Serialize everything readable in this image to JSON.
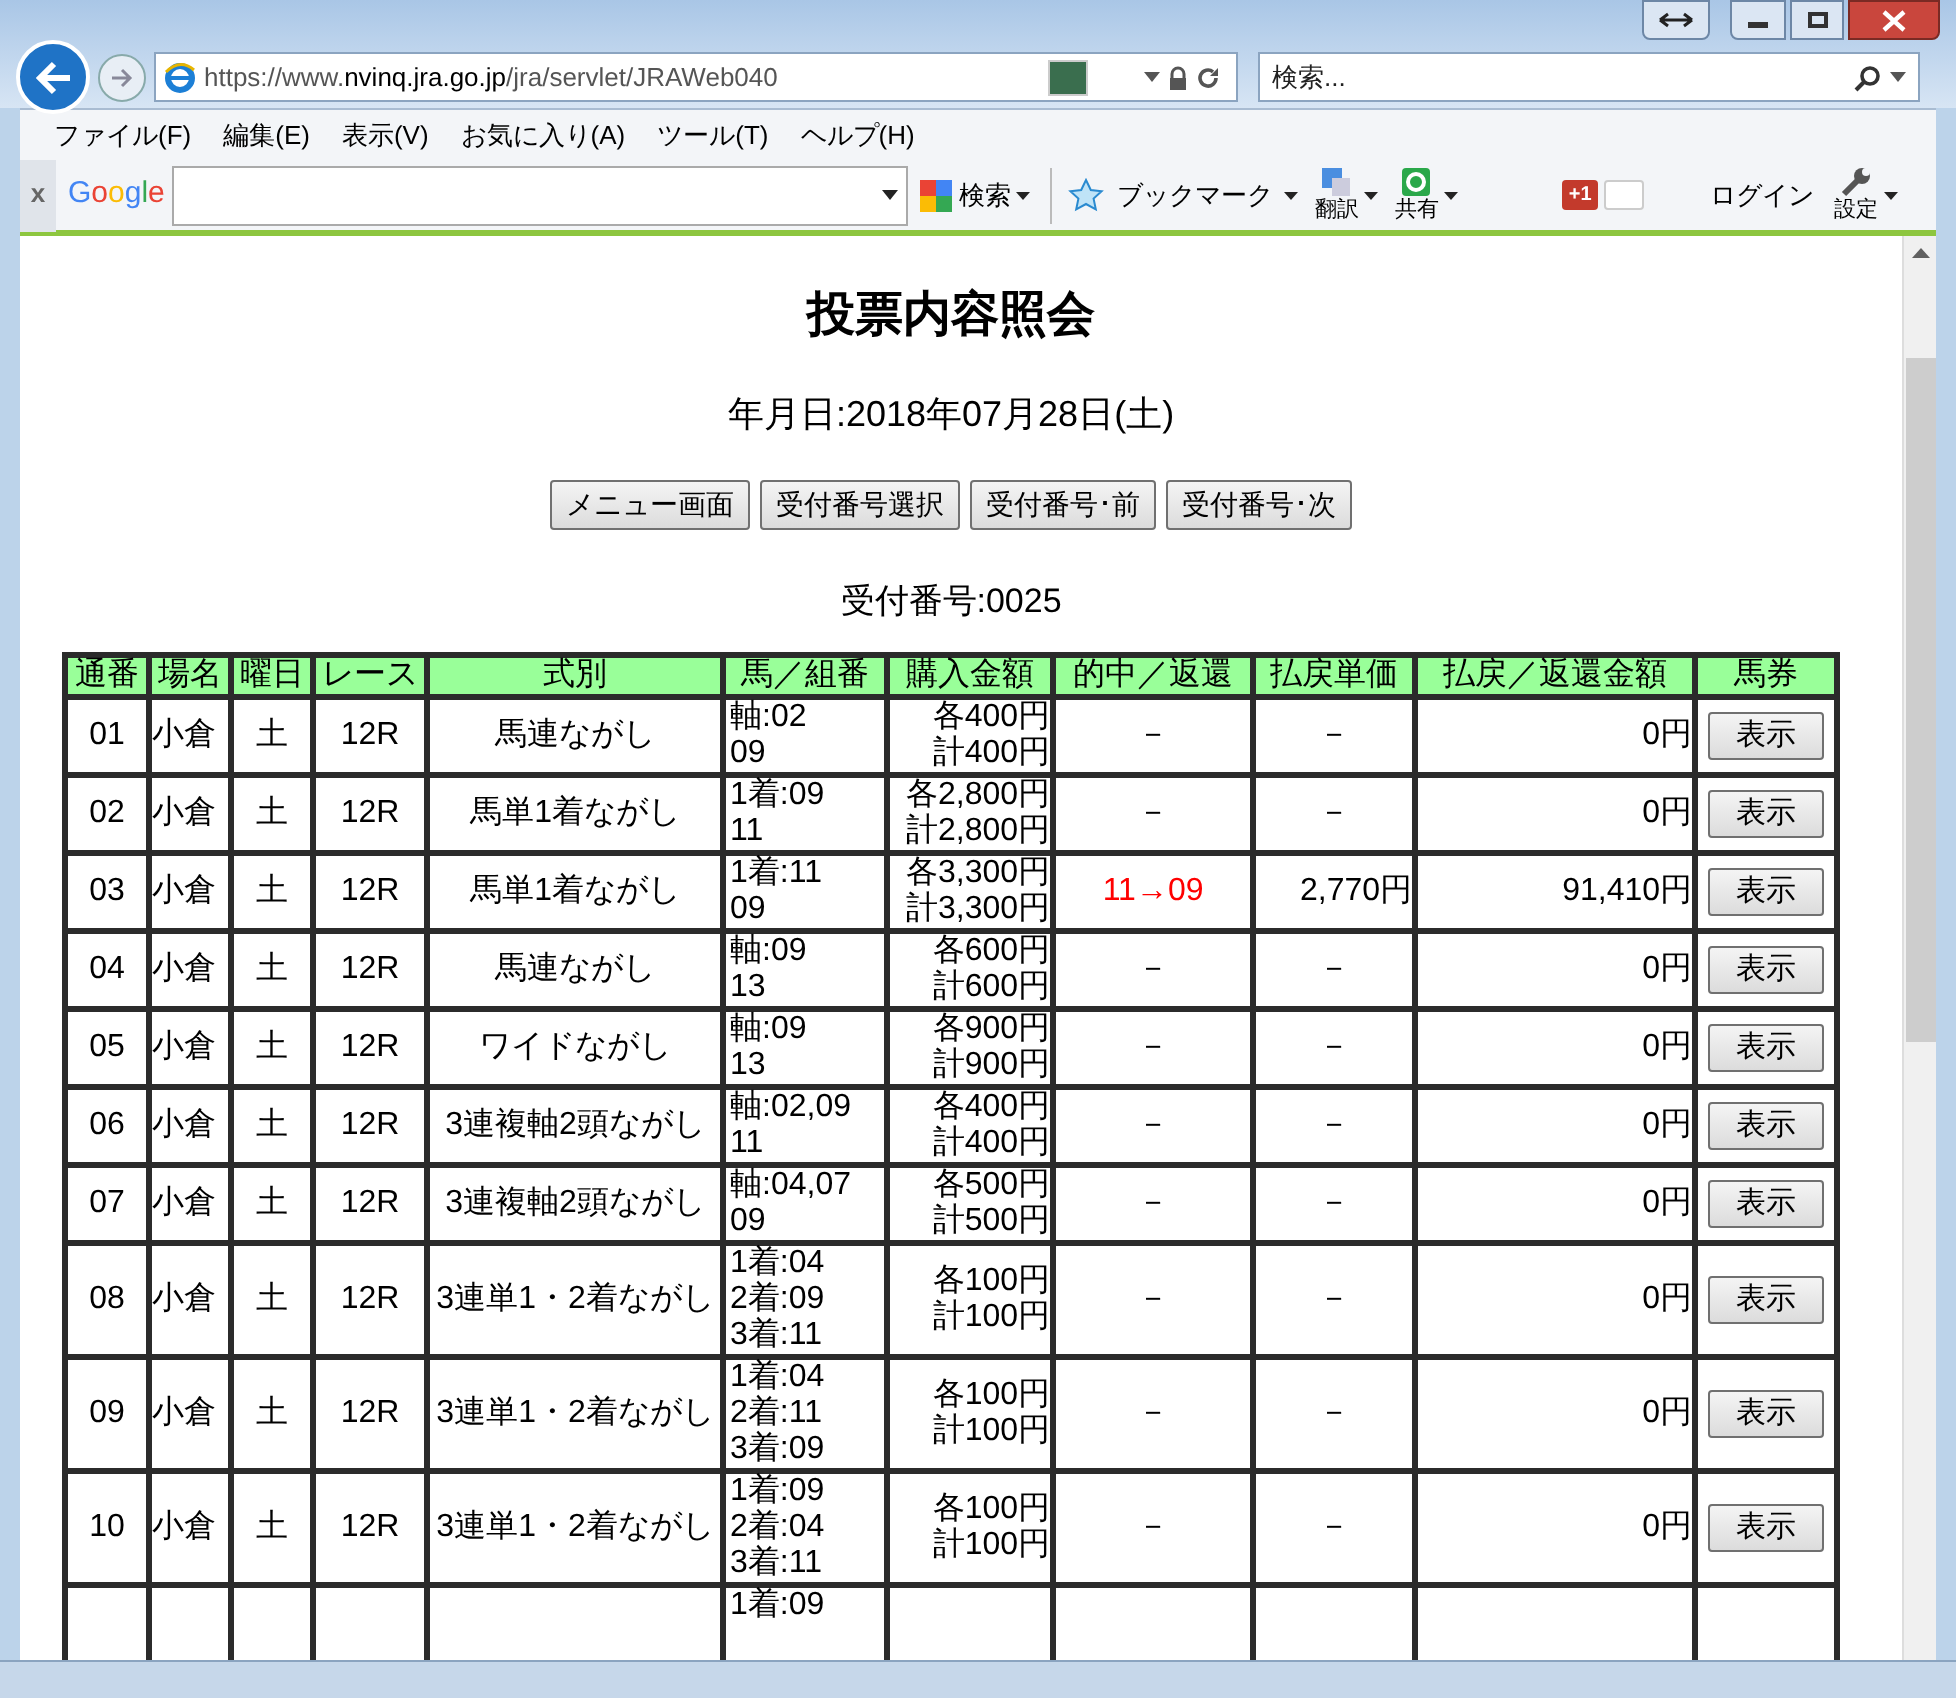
{
  "browser": {
    "url_prefix": "https://www.",
    "url_host": "nvinq.jra.go.jp",
    "url_path": "/jra/servlet/JRAWeb040",
    "search_placeholder": "検索..."
  },
  "menu_bar": [
    "ファイル(F)",
    "編集(E)",
    "表示(V)",
    "お気に入り(A)",
    "ツール(T)",
    "ヘルプ(H)"
  ],
  "toolbar": {
    "close": "x",
    "logo": "Google",
    "search": "検索",
    "bookmark": "ブックマーク",
    "translate": "翻訳",
    "share": "共有",
    "gplus": "+1",
    "login": "ログイン",
    "settings": "設定"
  },
  "page": {
    "title": "投票内容照会",
    "date": "年月日:2018年07月28日(土)",
    "buttons": [
      "メニュー画面",
      "受付番号選択",
      "受付番号･前",
      "受付番号･次"
    ],
    "receipt": "受付番号:0025",
    "table": {
      "columns": [
        "通番",
        "場名",
        "曜日",
        "レース",
        "式別",
        "馬／組番",
        "購入金額",
        "的中／返還",
        "払戻単価",
        "払戻／返還金額",
        "馬券"
      ],
      "rows": [
        {
          "kind": "full",
          "no": "01",
          "venue": "小倉",
          "day": "土",
          "race": "12R",
          "type": "馬連ながし",
          "combination": [
            "軸:02",
            "09"
          ],
          "amount": [
            "各400円",
            "計400円"
          ],
          "result": "－",
          "hit": false,
          "unit_payout": "－",
          "payout": "0円",
          "ticket": "表示"
        },
        {
          "kind": "full",
          "no": "02",
          "venue": "小倉",
          "day": "土",
          "race": "12R",
          "type": "馬単1着ながし",
          "combination": [
            "1着:09",
            "11"
          ],
          "amount": [
            "各2,800円",
            "計2,800円"
          ],
          "result": "－",
          "hit": false,
          "unit_payout": "－",
          "payout": "0円",
          "ticket": "表示"
        },
        {
          "kind": "full",
          "no": "03",
          "venue": "小倉",
          "day": "土",
          "race": "12R",
          "type": "馬単1着ながし",
          "combination": [
            "1着:11",
            "09"
          ],
          "amount": [
            "各3,300円",
            "計3,300円"
          ],
          "result": "11→09",
          "hit": true,
          "unit_payout": "2,770円",
          "payout": "91,410円",
          "ticket": "表示"
        },
        {
          "kind": "full",
          "no": "04",
          "venue": "小倉",
          "day": "土",
          "race": "12R",
          "type": "馬連ながし",
          "combination": [
            "軸:09",
            "13"
          ],
          "amount": [
            "各600円",
            "計600円"
          ],
          "result": "－",
          "hit": false,
          "unit_payout": "－",
          "payout": "0円",
          "ticket": "表示"
        },
        {
          "kind": "full",
          "no": "05",
          "venue": "小倉",
          "day": "土",
          "race": "12R",
          "type": "ワイドながし",
          "combination": [
            "軸:09",
            "13"
          ],
          "amount": [
            "各900円",
            "計900円"
          ],
          "result": "－",
          "hit": false,
          "unit_payout": "－",
          "payout": "0円",
          "ticket": "表示"
        },
        {
          "kind": "full",
          "no": "06",
          "venue": "小倉",
          "day": "土",
          "race": "12R",
          "type": "3連複軸2頭ながし",
          "combination": [
            "軸:02,09",
            "11"
          ],
          "amount": [
            "各400円",
            "計400円"
          ],
          "result": "－",
          "hit": false,
          "unit_payout": "－",
          "payout": "0円",
          "ticket": "表示"
        },
        {
          "kind": "full",
          "no": "07",
          "venue": "小倉",
          "day": "土",
          "race": "12R",
          "type": "3連複軸2頭ながし",
          "combination": [
            "軸:04,07",
            "09"
          ],
          "amount": [
            "各500円",
            "計500円"
          ],
          "result": "－",
          "hit": false,
          "unit_payout": "－",
          "payout": "0円",
          "ticket": "表示"
        },
        {
          "kind": "full",
          "no": "08",
          "venue": "小倉",
          "day": "土",
          "race": "12R",
          "type": "3連単1・2着ながし",
          "combination": [
            "1着:04",
            "2着:09",
            "3着:11"
          ],
          "amount": [
            "各100円",
            "計100円"
          ],
          "result": "－",
          "hit": false,
          "unit_payout": "－",
          "payout": "0円",
          "ticket": "表示"
        },
        {
          "kind": "full",
          "no": "09",
          "venue": "小倉",
          "day": "土",
          "race": "12R",
          "type": "3連単1・2着ながし",
          "combination": [
            "1着:04",
            "2着:11",
            "3着:09"
          ],
          "amount": [
            "各100円",
            "計100円"
          ],
          "result": "－",
          "hit": false,
          "unit_payout": "－",
          "payout": "0円",
          "ticket": "表示"
        },
        {
          "kind": "full",
          "no": "10",
          "venue": "小倉",
          "day": "土",
          "race": "12R",
          "type": "3連単1・2着ながし",
          "combination": [
            "1着:09",
            "2着:04",
            "3着:11"
          ],
          "amount": [
            "各100円",
            "計100円"
          ],
          "result": "－",
          "hit": false,
          "unit_payout": "－",
          "payout": "0円",
          "ticket": "表示"
        },
        {
          "kind": "partial",
          "combination": [
            "1着:09"
          ]
        }
      ]
    }
  }
}
